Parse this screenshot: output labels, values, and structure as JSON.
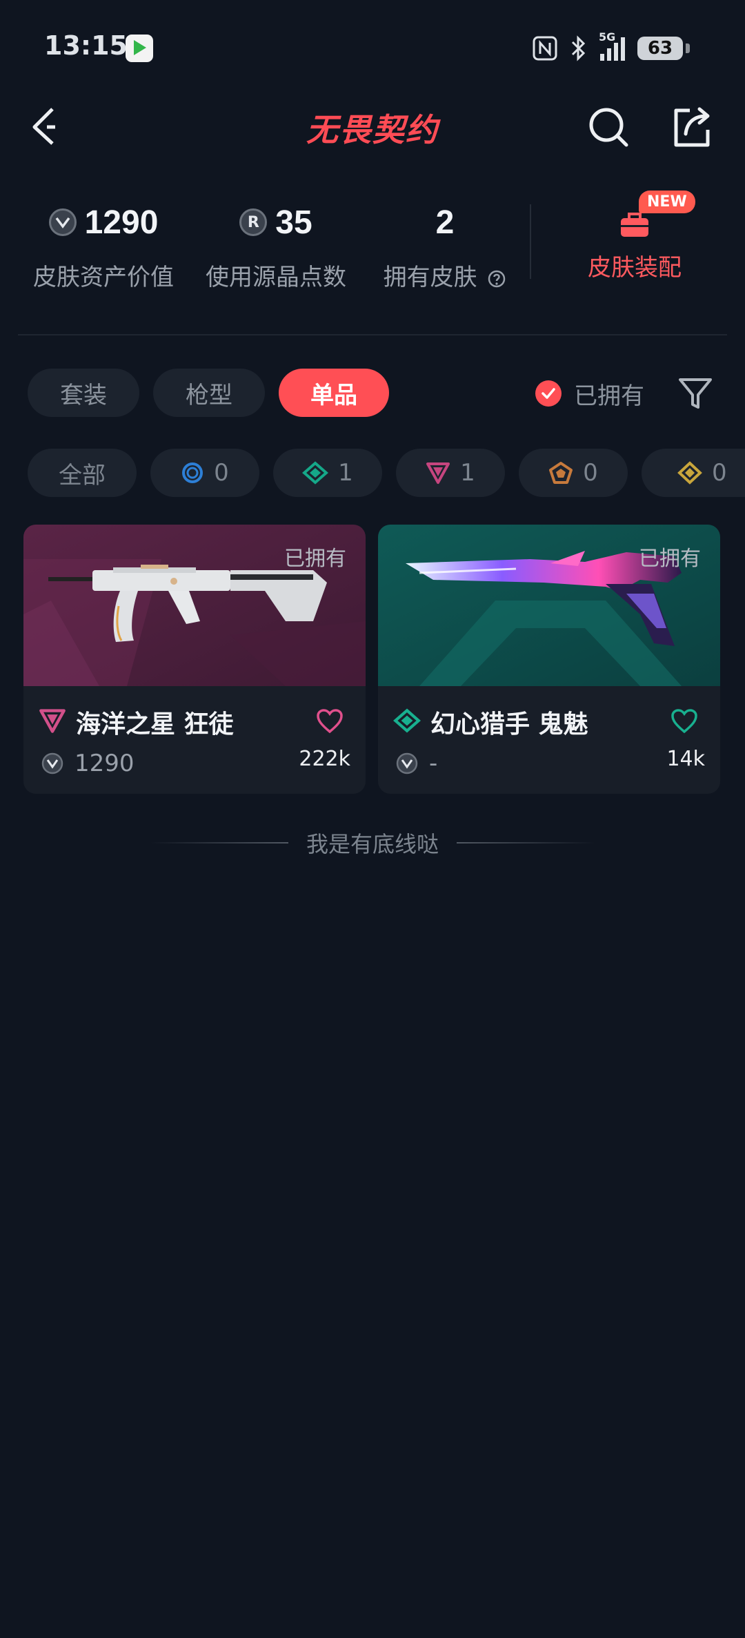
{
  "status_bar": {
    "time": "13:15",
    "signal": "5G",
    "battery": "63"
  },
  "nav": {
    "logo_text": "无畏契约"
  },
  "stats": [
    {
      "value": "1290",
      "label": "皮肤资产价值",
      "icon": "vp-icon"
    },
    {
      "value": "35",
      "label": "使用源晶点数",
      "icon": "radianite-icon"
    },
    {
      "value": "2",
      "label": "拥有皮肤",
      "icon": "help-icon"
    }
  ],
  "equip": {
    "badge": "NEW",
    "label": "皮肤装配",
    "icon": "briefcase-icon"
  },
  "tabs": [
    "套装",
    "枪型",
    "单品"
  ],
  "active_tab": "单品",
  "owned_filter": {
    "label": "已拥有",
    "checked": true
  },
  "tier_chips": [
    {
      "label": "全部"
    },
    {
      "label": "0",
      "tier": "select",
      "color": "#2d7fd6"
    },
    {
      "label": "1",
      "tier": "deluxe",
      "color": "#15a889"
    },
    {
      "label": "1",
      "tier": "premium",
      "color": "#c6457f"
    },
    {
      "label": "0",
      "tier": "exclusive",
      "color": "#c77a3c"
    },
    {
      "label": "0",
      "tier": "ultra",
      "color": "#c9a63c"
    }
  ],
  "cards": [
    {
      "owned": "已拥有",
      "name": "海洋之星 狂徒",
      "price": "1290",
      "likes": "222k",
      "tier_color": "#d2508a",
      "heart_color": "#e0508c"
    },
    {
      "owned": "已拥有",
      "name": "幻心猎手 鬼魅",
      "price": "-",
      "likes": "14k",
      "tier_color": "#18b08f",
      "heart_color": "#18b08f"
    }
  ],
  "footer": "我是有底线哒"
}
